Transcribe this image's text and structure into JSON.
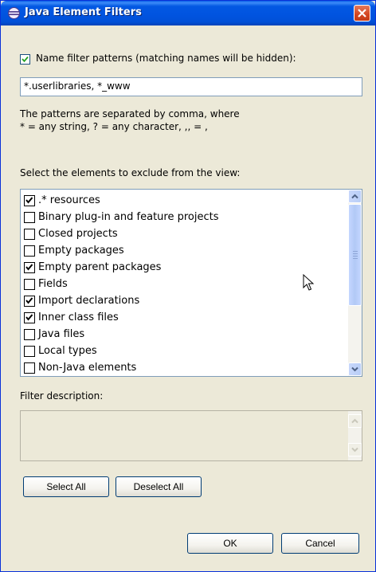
{
  "window": {
    "title": "Java Element Filters",
    "icons": {
      "app": "java-eclipse-icon",
      "close": "close-icon"
    },
    "colors": {
      "title_bar": "#0154e0",
      "close": "#d4451f",
      "face": "#ece9d8"
    }
  },
  "name_filter": {
    "checkbox_label": "Name filter patterns (matching names will be hidden):",
    "checked": true,
    "value": "*.userlibraries, *_www",
    "help_line1": "The patterns are separated by comma, where",
    "help_line2": "* = any string, ? = any character, ,, = ,"
  },
  "exclude": {
    "label": "Select the elements to exclude from the view:",
    "items": [
      {
        "label": ".* resources",
        "checked": true
      },
      {
        "label": "Binary plug-in and feature projects",
        "checked": false
      },
      {
        "label": "Closed projects",
        "checked": false
      },
      {
        "label": "Empty packages",
        "checked": false
      },
      {
        "label": "Empty parent packages",
        "checked": true
      },
      {
        "label": "Fields",
        "checked": false
      },
      {
        "label": "Import declarations",
        "checked": true
      },
      {
        "label": "Inner class files",
        "checked": true
      },
      {
        "label": "Java files",
        "checked": false
      },
      {
        "label": "Local types",
        "checked": false
      },
      {
        "label": "Non-Java elements",
        "checked": false
      }
    ]
  },
  "description": {
    "label": "Filter description:",
    "text": ""
  },
  "buttons": {
    "select_all": "Select All",
    "deselect_all": "Deselect All",
    "ok": "OK",
    "cancel": "Cancel"
  }
}
